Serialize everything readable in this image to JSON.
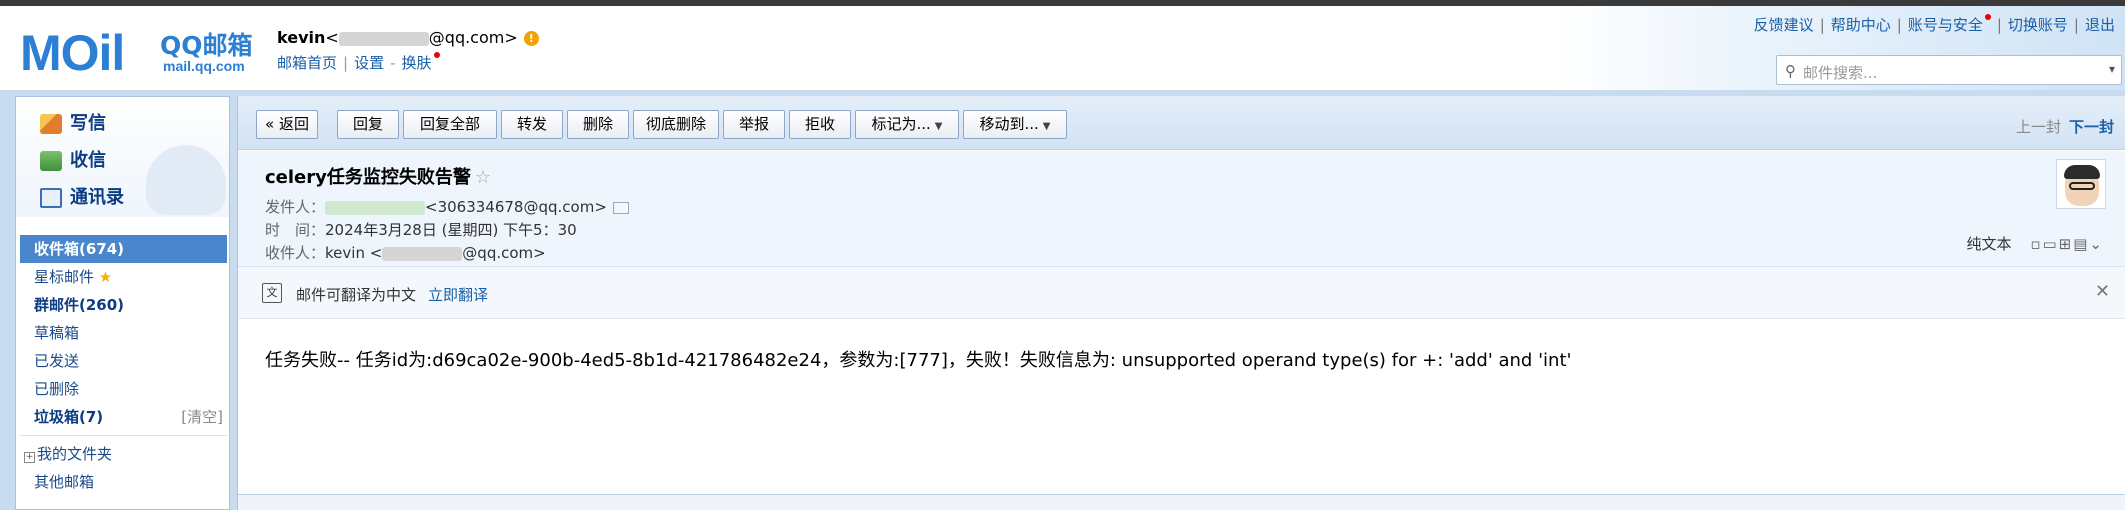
{
  "header": {
    "logo_text": "MOil",
    "logo_brand": "QQ邮箱",
    "logo_url": "mail.qq.com",
    "user_name": "kevin",
    "user_email_suffix": "@qq.com>",
    "links": [
      "邮箱首页",
      "设置",
      "换肤"
    ],
    "top_links": [
      "反馈建议",
      "帮助中心",
      "账号与安全",
      "切换账号",
      "退出"
    ],
    "search_placeholder": "邮件搜索..."
  },
  "sidebar": {
    "compose": "写信",
    "inbox_link": "收信",
    "contacts": "通讯录",
    "folders": [
      {
        "label": "收件箱(674)"
      },
      {
        "label": "星标邮件"
      },
      {
        "label": "群邮件(260)"
      },
      {
        "label": "草稿箱"
      },
      {
        "label": "已发送"
      },
      {
        "label": "已删除"
      },
      {
        "label": "垃圾箱(7)",
        "action": "[清空]"
      },
      {
        "label": "我的文件夹"
      },
      {
        "label": "其他邮箱"
      }
    ]
  },
  "toolbar": {
    "back": "« 返回",
    "reply": "回复",
    "reply_all": "回复全部",
    "forward": "转发",
    "delete": "删除",
    "delete_forever": "彻底删除",
    "report": "举报",
    "reject": "拒收",
    "mark_as": "标记为...",
    "move_to": "移动到...",
    "prev": "上一封",
    "next": "下一封"
  },
  "mail": {
    "subject": "celery任务监控失败告警",
    "from_label": "发件人：",
    "from_value": "<306334678@qq.com>",
    "time_label": "时　间：",
    "time_value": "2024年3月28日 (星期四) 下午5：30",
    "to_label": "收件人：",
    "to_value_prefix": "kevin <",
    "to_value_suffix": "@qq.com>",
    "plain_text": "纯文本",
    "translate_hint": "邮件可翻译为中文",
    "translate_link": "立即翻译",
    "body": "任务失败-- 任务id为:d69ca02e-900b-4ed5-8b1d-421786482e24，参数为:[777]，失败！失败信息为: unsupported operand type(s) for +: 'add' and 'int'"
  },
  "colors": {
    "brand": "#2c7fd3",
    "link": "#1a5fa8",
    "active_folder": "#4a86cc"
  }
}
